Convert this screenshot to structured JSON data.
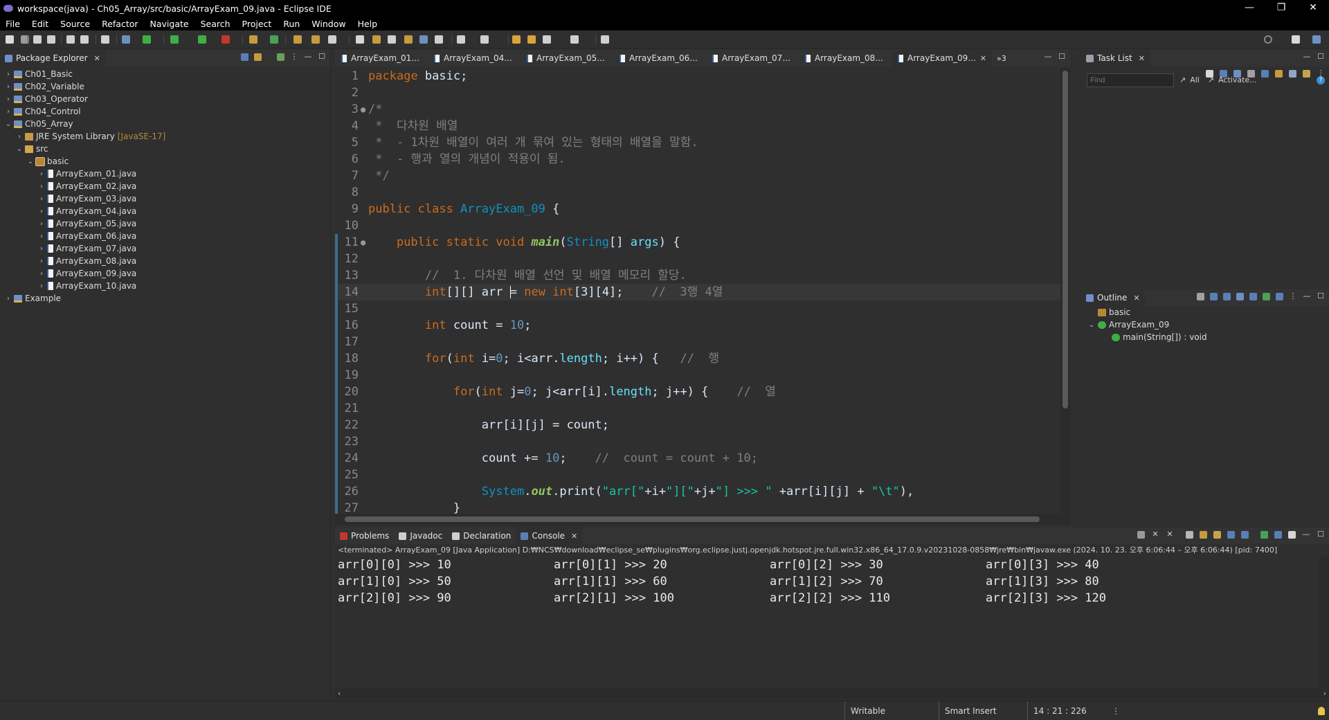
{
  "window": {
    "title": "workspace(java) - Ch05_Array/src/basic/ArrayExam_09.java - Eclipse IDE",
    "controls": [
      "—",
      "❐",
      "✕"
    ]
  },
  "menu": [
    "File",
    "Edit",
    "Source",
    "Refactor",
    "Navigate",
    "Search",
    "Project",
    "Run",
    "Window",
    "Help"
  ],
  "package_explorer": {
    "title": "Package Explorer",
    "items": [
      {
        "label": "Ch01_Basic",
        "indent": 0,
        "twisty": "›",
        "icon": "project"
      },
      {
        "label": "Ch02_Variable",
        "indent": 0,
        "twisty": "›",
        "icon": "project"
      },
      {
        "label": "Ch03_Operator",
        "indent": 0,
        "twisty": "›",
        "icon": "project"
      },
      {
        "label": "Ch04_Control",
        "indent": 0,
        "twisty": "›",
        "icon": "project"
      },
      {
        "label": "Ch05_Array",
        "indent": 0,
        "twisty": "⌄",
        "icon": "project"
      },
      {
        "label": "JRE System Library",
        "decor": "[JavaSE-17]",
        "indent": 1,
        "twisty": "›",
        "icon": "lib"
      },
      {
        "label": "src",
        "indent": 1,
        "twisty": "⌄",
        "icon": "src"
      },
      {
        "label": "basic",
        "indent": 2,
        "twisty": "⌄",
        "icon": "pkg"
      },
      {
        "label": "ArrayExam_01.java",
        "indent": 3,
        "twisty": "›",
        "icon": "java"
      },
      {
        "label": "ArrayExam_02.java",
        "indent": 3,
        "twisty": "›",
        "icon": "java"
      },
      {
        "label": "ArrayExam_03.java",
        "indent": 3,
        "twisty": "›",
        "icon": "java"
      },
      {
        "label": "ArrayExam_04.java",
        "indent": 3,
        "twisty": "›",
        "icon": "java"
      },
      {
        "label": "ArrayExam_05.java",
        "indent": 3,
        "twisty": "›",
        "icon": "java"
      },
      {
        "label": "ArrayExam_06.java",
        "indent": 3,
        "twisty": "›",
        "icon": "java"
      },
      {
        "label": "ArrayExam_07.java",
        "indent": 3,
        "twisty": "›",
        "icon": "java"
      },
      {
        "label": "ArrayExam_08.java",
        "indent": 3,
        "twisty": "›",
        "icon": "java"
      },
      {
        "label": "ArrayExam_09.java",
        "indent": 3,
        "twisty": "›",
        "icon": "java"
      },
      {
        "label": "ArrayExam_10.java",
        "indent": 3,
        "twisty": "›",
        "icon": "java"
      },
      {
        "label": "Example",
        "indent": 0,
        "twisty": "›",
        "icon": "project"
      }
    ]
  },
  "editor": {
    "tabs": [
      "ArrayExam_01...",
      "ArrayExam_04...",
      "ArrayExam_05...",
      "ArrayExam_06...",
      "ArrayExam_07...",
      "ArrayExam_08...",
      "ArrayExam_09..."
    ],
    "active_tab": 6,
    "overflow": "»3",
    "current_line": 14,
    "lines": [
      {
        "n": 1,
        "tokens": [
          [
            "kw",
            "package"
          ],
          [
            "id",
            " basic;"
          ]
        ]
      },
      {
        "n": 2,
        "tokens": []
      },
      {
        "n": 3,
        "fold": "●",
        "tokens": [
          [
            "cm",
            "/*"
          ]
        ]
      },
      {
        "n": 4,
        "tokens": [
          [
            "cm",
            " *  다차원 배열"
          ]
        ]
      },
      {
        "n": 5,
        "tokens": [
          [
            "cm",
            " *  - 1차원 배열이 여러 개 묶여 있는 형태의 배열을 말함."
          ]
        ]
      },
      {
        "n": 6,
        "tokens": [
          [
            "cm",
            " *  - 행과 열의 개념이 적용이 됨."
          ]
        ]
      },
      {
        "n": 7,
        "tokens": [
          [
            "cm",
            " */"
          ]
        ]
      },
      {
        "n": 8,
        "tokens": []
      },
      {
        "n": 9,
        "tokens": [
          [
            "kw",
            "public class "
          ],
          [
            "cls",
            "ArrayExam_09"
          ],
          [
            "id",
            " {"
          ]
        ]
      },
      {
        "n": 10,
        "tokens": []
      },
      {
        "n": 11,
        "fold": "●",
        "tokens": [
          [
            "id",
            "    "
          ],
          [
            "kw",
            "public static void "
          ],
          [
            "stat",
            "main"
          ],
          [
            "id",
            "("
          ],
          [
            "cls",
            "String"
          ],
          [
            "id",
            "[] "
          ],
          [
            "fld",
            "args"
          ],
          [
            "id",
            ") {"
          ]
        ]
      },
      {
        "n": 12,
        "tokens": []
      },
      {
        "n": 13,
        "tokens": [
          [
            "id",
            "        "
          ],
          [
            "cm",
            "//  1. 다차원 배열 선언 및 배열 메모리 할당."
          ]
        ]
      },
      {
        "n": 14,
        "tokens": [
          [
            "id",
            "        "
          ],
          [
            "kw",
            "int"
          ],
          [
            "id",
            "[][] arr "
          ],
          [
            "caret",
            ""
          ],
          [
            "id",
            "= "
          ],
          [
            "kw",
            "new int"
          ],
          [
            "id",
            "[3][4];    "
          ],
          [
            "cm",
            "//  3행 4열"
          ]
        ]
      },
      {
        "n": 15,
        "tokens": []
      },
      {
        "n": 16,
        "tokens": [
          [
            "id",
            "        "
          ],
          [
            "kw",
            "int"
          ],
          [
            "id",
            " count = "
          ],
          [
            "num",
            "10"
          ],
          [
            "id",
            ";"
          ]
        ]
      },
      {
        "n": 17,
        "tokens": []
      },
      {
        "n": 18,
        "tokens": [
          [
            "id",
            "        "
          ],
          [
            "kw",
            "for"
          ],
          [
            "id",
            "("
          ],
          [
            "kw",
            "int"
          ],
          [
            "id",
            " i="
          ],
          [
            "num",
            "0"
          ],
          [
            "id",
            "; i<arr."
          ],
          [
            "fld",
            "length"
          ],
          [
            "id",
            "; i++) {   "
          ],
          [
            "cm",
            "//  행"
          ]
        ]
      },
      {
        "n": 19,
        "tokens": []
      },
      {
        "n": 20,
        "tokens": [
          [
            "id",
            "            "
          ],
          [
            "kw",
            "for"
          ],
          [
            "id",
            "("
          ],
          [
            "kw",
            "int"
          ],
          [
            "id",
            " j="
          ],
          [
            "num",
            "0"
          ],
          [
            "id",
            "; j<arr[i]."
          ],
          [
            "fld",
            "length"
          ],
          [
            "id",
            "; j++) {    "
          ],
          [
            "cm",
            "//  열"
          ]
        ]
      },
      {
        "n": 21,
        "tokens": []
      },
      {
        "n": 22,
        "tokens": [
          [
            "id",
            "                arr[i][j] = count;"
          ]
        ]
      },
      {
        "n": 23,
        "tokens": []
      },
      {
        "n": 24,
        "tokens": [
          [
            "id",
            "                count += "
          ],
          [
            "num",
            "10"
          ],
          [
            "id",
            ";    "
          ],
          [
            "cm",
            "//  count = count + 10;"
          ]
        ]
      },
      {
        "n": 25,
        "tokens": []
      },
      {
        "n": 26,
        "tokens": [
          [
            "id",
            "                "
          ],
          [
            "cls",
            "System"
          ],
          [
            "id",
            "."
          ],
          [
            "stat",
            "out"
          ],
          [
            "id",
            ".print("
          ],
          [
            "str",
            "\"arr[\""
          ],
          [
            "id",
            "+i+"
          ],
          [
            "str",
            "\"][\""
          ],
          [
            "id",
            "+j+"
          ],
          [
            "str",
            "\"] >>> \""
          ],
          [
            "id",
            " +arr[i][j] + "
          ],
          [
            "str",
            "\"\\t\""
          ],
          [
            "id",
            "),"
          ]
        ]
      },
      {
        "n": 27,
        "tokens": [
          [
            "id",
            "            }"
          ]
        ]
      }
    ]
  },
  "task_list": {
    "title": "Task List",
    "find_placeholder": "Find",
    "all_label": "All",
    "activate_label": "Activate..."
  },
  "outline": {
    "title": "Outline",
    "items": [
      {
        "label": "basic",
        "indent": 0
      },
      {
        "label": "ArrayExam_09",
        "indent": 0,
        "twisty": "⌄"
      },
      {
        "label": "main(String[]) : void",
        "indent": 1
      }
    ]
  },
  "bottom": {
    "tabs": [
      "Problems",
      "Javadoc",
      "Declaration",
      "Console"
    ],
    "active_tab": 3,
    "console_header": "<terminated> ArrayExam_09 [Java Application] D:₩NCS₩download₩eclipse_se₩plugins₩org.eclipse.justj.openjdk.hotspot.jre.full.win32.x86_64_17.0.9.v20231028-0858₩jre₩bin₩javaw.exe  (2024. 10. 23. 오후 6:06:44 – 오후 6:06:44) [pid: 7400]",
    "output": [
      [
        "arr[0][0] >>> 10",
        "arr[0][1] >>> 20",
        "arr[0][2] >>> 30",
        "arr[0][3] >>> 40"
      ],
      [
        "arr[1][0] >>> 50",
        "arr[1][1] >>> 60",
        "arr[1][2] >>> 70",
        "arr[1][3] >>> 80"
      ],
      [
        "arr[2][0] >>> 90",
        "arr[2][1] >>> 100",
        "arr[2][2] >>> 110",
        "arr[2][3] >>> 120"
      ]
    ]
  },
  "status": {
    "writable": "Writable",
    "insert_mode": "Smart Insert",
    "position": "14 : 21 : 226"
  }
}
